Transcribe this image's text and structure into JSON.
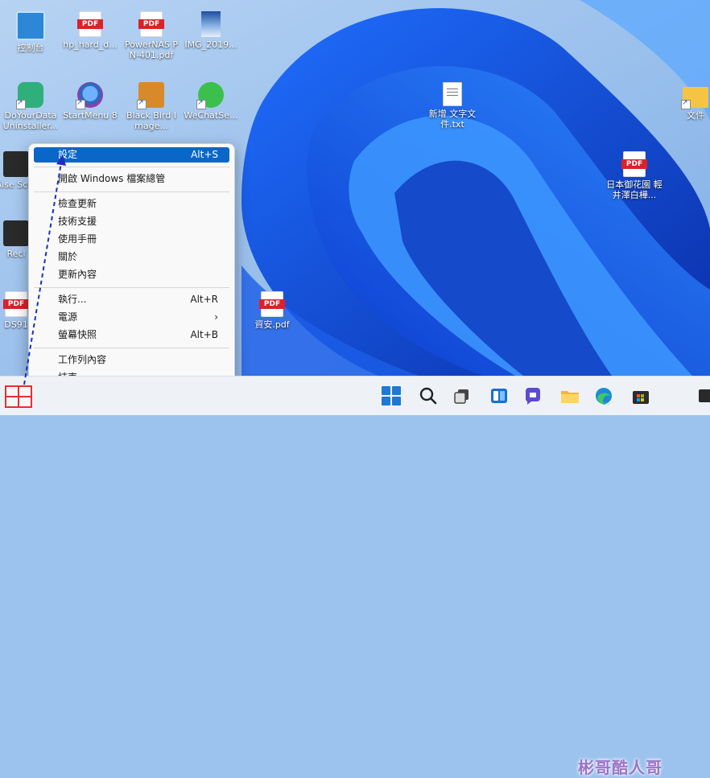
{
  "desktop": {
    "icons": [
      {
        "label": "控制台"
      },
      {
        "label": "hp_hard_d..."
      },
      {
        "label": "PowerNAS PN-401.pdf"
      },
      {
        "label": "IMG_2019..."
      },
      {
        "label": "DoYourData Uninstaller..."
      },
      {
        "label": "StartMenu 8"
      },
      {
        "label": "Black Bird Image..."
      },
      {
        "label": "WeChatSe..."
      },
      {
        "label": "新增 文字文件.txt"
      },
      {
        "label": "文件"
      },
      {
        "label": "日本御花園 輕井澤白樺..."
      },
      {
        "label": "Aise Scre"
      },
      {
        "label": "Recl"
      },
      {
        "label": "e"
      },
      {
        "label": "DS91"
      },
      {
        "label": "資安.pdf"
      }
    ]
  },
  "context_menu": {
    "items": [
      {
        "label": "設定",
        "shortcut": "Alt+S"
      },
      {
        "label": "開啟 Windows 檔案總管"
      },
      {
        "label": "檢查更新"
      },
      {
        "label": "技術支援"
      },
      {
        "label": "使用手冊"
      },
      {
        "label": "關於"
      },
      {
        "label": "更新內容"
      },
      {
        "label": "執行...",
        "shortcut": "Alt+R"
      },
      {
        "label": "電源",
        "submenu_arrow": "›"
      },
      {
        "label": "螢幕快照",
        "shortcut": "Alt+B"
      },
      {
        "label": "工作列內容"
      },
      {
        "label": "結束"
      }
    ]
  },
  "taskbar": {
    "apps": [
      "start-icon",
      "search-icon",
      "task-view-icon",
      "widgets-icon",
      "chat-icon",
      "file-explorer-icon",
      "edge-icon",
      "store-icon",
      "terminal-icon"
    ]
  },
  "watermark": "彬哥酷人哥",
  "colors": {
    "menu_highlight": "#0a67c8",
    "annotation_red": "#e53030",
    "annotation_blue": "#1a2fbf"
  }
}
